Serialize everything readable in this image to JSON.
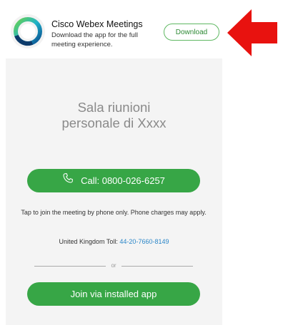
{
  "banner": {
    "app_name": "Cisco Webex Meetings",
    "description": "Download the app for the full meeting experience.",
    "download_label": "Download",
    "logo_icon": "webex-logo-icon"
  },
  "arrow": {
    "icon": "red-arrow-left-icon",
    "color": "#e8120f"
  },
  "main": {
    "room_title_line1": "Sala riunioni",
    "room_title_line2": "personale di Xxxx",
    "call_label": "Call: 0800-026-6257",
    "call_icon": "phone-icon",
    "tap_note": "Tap to join the meeting by phone only. Phone charges may apply.",
    "toll_label": "United Kingdom Toll:",
    "toll_number": "44-20-7660-8149",
    "divider_text": "or",
    "join_label": "Join via installed app"
  },
  "colors": {
    "accent_green": "#37a646",
    "link_blue": "#2a86c8",
    "panel_gray": "#f4f4f4"
  }
}
